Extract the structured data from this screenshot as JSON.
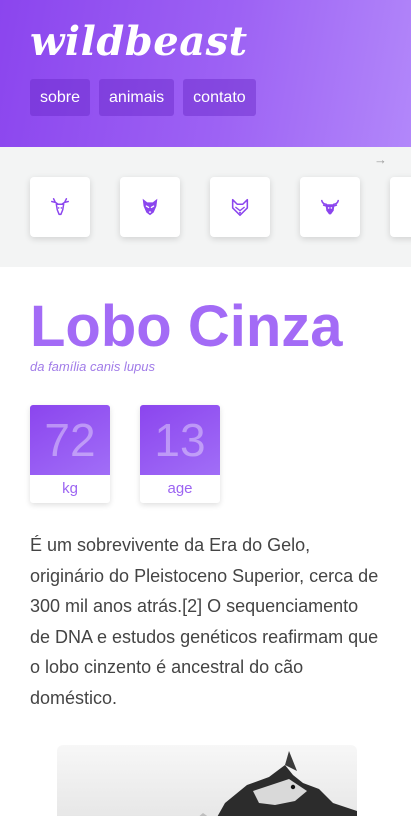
{
  "header": {
    "logo": "wildbeast",
    "nav": [
      {
        "label": "sobre"
      },
      {
        "label": "animais"
      },
      {
        "label": "contato"
      }
    ]
  },
  "carousel": {
    "scroll_hint": "→",
    "animals": [
      {
        "icon": "deer-icon"
      },
      {
        "icon": "wolf-icon"
      },
      {
        "icon": "fox-icon"
      },
      {
        "icon": "bull-icon"
      },
      {
        "icon": "animal-icon"
      }
    ]
  },
  "animal": {
    "name": "Lobo Cinza",
    "family": "da família canis lupus",
    "stats": [
      {
        "value": "72",
        "label": "kg"
      },
      {
        "value": "13",
        "label": "age"
      }
    ],
    "description": "É um sobrevivente da Era do Gelo, originário do Pleistoceno Superior, cerca de 300 mil anos atrás.[2] O sequenciamento de DNA e estudos genéticos reafirmam que o lobo cinzento é ancestral do cão doméstico."
  },
  "colors": {
    "accent": "#9c5ff4",
    "accent_light": "#b287fa",
    "text": "#444444"
  }
}
